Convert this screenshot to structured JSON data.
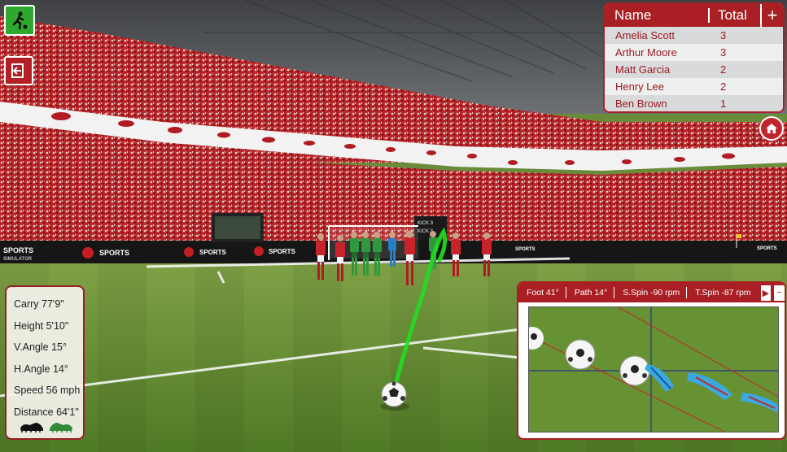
{
  "leaderboard": {
    "header_name": "Name",
    "header_total": "Total",
    "add_label": "+",
    "rows": [
      {
        "name": "Amelia Scott",
        "total": "3"
      },
      {
        "name": "Arthur Moore",
        "total": "3"
      },
      {
        "name": "Matt Garcia",
        "total": "2"
      },
      {
        "name": "Henry Lee",
        "total": "2"
      },
      {
        "name": "Ben Brown",
        "total": "1"
      }
    ]
  },
  "stats": {
    "carry": "Carry 77'9\"",
    "height": "Height 5'10\"",
    "v_angle": "V.Angle 15°",
    "h_angle": "H.Angle 14°",
    "speed": "Speed 56 mph",
    "distance": "Distance 64'1\""
  },
  "tracking": {
    "foot": "Foot 41°",
    "path": "Path 14°",
    "s_spin": "S.Spin -90 rpm",
    "t_spin": "T.Spin -87 rpm",
    "play_label": "▶",
    "minus_label": "−"
  },
  "branding": {
    "board_text": "SPORTS",
    "board_sub": "SIMULATOR",
    "scoreboard_line1": "KICK 3",
    "scoreboard_line2": "KICK 3"
  },
  "colors": {
    "accent": "#a91f24",
    "mode_button": "#2ea82e",
    "ball_path": "#22dd22"
  },
  "icons": {
    "mode": "kicking-player-icon",
    "exit": "exit-icon",
    "home": "home-icon",
    "left_foot": "black-boot-icon",
    "right_foot": "green-boot-icon"
  }
}
